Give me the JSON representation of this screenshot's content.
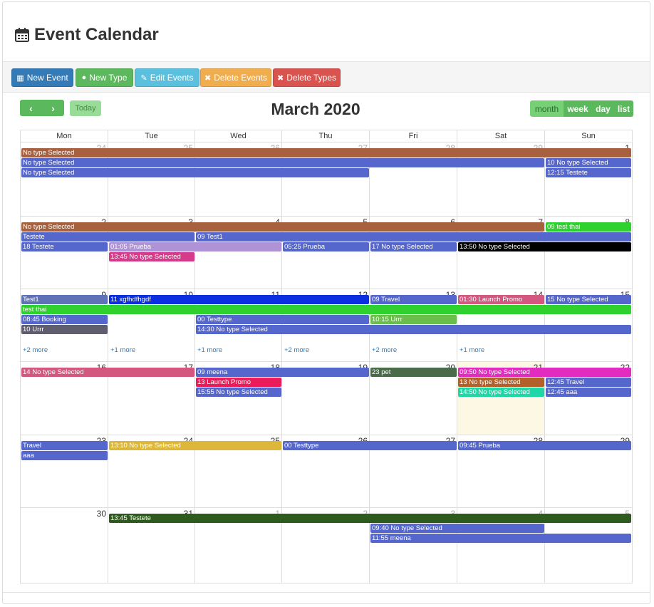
{
  "header": {
    "title": "Event Calendar"
  },
  "toolbar": {
    "new_event": "New Event",
    "new_type": "New Type",
    "edit_events": "Edit Events",
    "delete_events": "Delete Events",
    "delete_types": "Delete Types"
  },
  "calendar": {
    "title": "March 2020",
    "today": "Today",
    "views": [
      "month",
      "week",
      "day",
      "list"
    ],
    "active_view": "month",
    "weekdays": [
      "Mon",
      "Tue",
      "Wed",
      "Thu",
      "Fri",
      "Sat",
      "Sun"
    ],
    "weeks": [
      [
        {
          "d": "24",
          "o": true
        },
        {
          "d": "25",
          "o": true
        },
        {
          "d": "26",
          "o": true
        },
        {
          "d": "27",
          "o": true
        },
        {
          "d": "28",
          "o": true
        },
        {
          "d": "29",
          "o": true
        },
        {
          "d": "1"
        }
      ],
      [
        {
          "d": "2"
        },
        {
          "d": "3"
        },
        {
          "d": "4"
        },
        {
          "d": "5"
        },
        {
          "d": "6"
        },
        {
          "d": "7"
        },
        {
          "d": "8"
        }
      ],
      [
        {
          "d": "9"
        },
        {
          "d": "10"
        },
        {
          "d": "11"
        },
        {
          "d": "12"
        },
        {
          "d": "13"
        },
        {
          "d": "14"
        },
        {
          "d": "15"
        }
      ],
      [
        {
          "d": "16"
        },
        {
          "d": "17"
        },
        {
          "d": "18"
        },
        {
          "d": "19"
        },
        {
          "d": "20"
        },
        {
          "d": "21",
          "today": true
        },
        {
          "d": "22"
        }
      ],
      [
        {
          "d": "23"
        },
        {
          "d": "24"
        },
        {
          "d": "25"
        },
        {
          "d": "26"
        },
        {
          "d": "27"
        },
        {
          "d": "28"
        },
        {
          "d": "29"
        }
      ],
      [
        {
          "d": "30"
        },
        {
          "d": "31"
        },
        {
          "d": "1",
          "o": true
        },
        {
          "d": "2",
          "o": true
        },
        {
          "d": "3",
          "o": true
        },
        {
          "d": "4",
          "o": true
        },
        {
          "d": "5",
          "o": true
        }
      ]
    ],
    "events": [
      {
        "week": 0,
        "start": 0,
        "end": 6,
        "slot": 0,
        "label": "No type Selected",
        "color": "#a8613e"
      },
      {
        "week": 0,
        "start": 0,
        "end": 5,
        "slot": 1,
        "label": "No type Selected",
        "color": "#5566cc"
      },
      {
        "week": 0,
        "start": 6,
        "end": 6,
        "slot": 1,
        "label": "10 No type Selected",
        "color": "#5566cc"
      },
      {
        "week": 0,
        "start": 0,
        "end": 3,
        "slot": 2,
        "label": "No type Selected",
        "color": "#5566cc"
      },
      {
        "week": 0,
        "start": 6,
        "end": 6,
        "slot": 2,
        "label": "12:15 Testete",
        "color": "#5566cc"
      },
      {
        "week": 1,
        "start": 0,
        "end": 5,
        "slot": 0,
        "label": "No type Selected",
        "color": "#a8613e"
      },
      {
        "week": 1,
        "start": 6,
        "end": 6,
        "slot": 0,
        "label": "09 test thai",
        "color": "#2ed12e"
      },
      {
        "week": 1,
        "start": 0,
        "end": 1,
        "slot": 1,
        "label": "Testete",
        "color": "#5566cc"
      },
      {
        "week": 1,
        "start": 2,
        "end": 6,
        "slot": 1,
        "label": "09 Test1",
        "color": "#5566cc"
      },
      {
        "week": 1,
        "start": 0,
        "end": 0,
        "slot": 2,
        "label": "18 Testete",
        "color": "#5566cc"
      },
      {
        "week": 1,
        "start": 1,
        "end": 2,
        "slot": 2,
        "label": "01:05 Prueba",
        "color": "#b092d6"
      },
      {
        "week": 1,
        "start": 3,
        "end": 3,
        "slot": 2,
        "label": "05:25 Prueba",
        "color": "#5566cc"
      },
      {
        "week": 1,
        "start": 4,
        "end": 4,
        "slot": 2,
        "label": "17 No type Selected",
        "color": "#5566cc"
      },
      {
        "week": 1,
        "start": 5,
        "end": 6,
        "slot": 2,
        "label": "13:50 No type Selected",
        "color": "#000000"
      },
      {
        "week": 1,
        "start": 1,
        "end": 1,
        "slot": 3,
        "label": "13:45 No type Selected",
        "color": "#d63a8a"
      },
      {
        "week": 2,
        "start": 0,
        "end": 0,
        "slot": 0,
        "label": "Test1",
        "color": "#5f72b8"
      },
      {
        "week": 2,
        "start": 1,
        "end": 3,
        "slot": 0,
        "label": "11 xgfhdfhgdf",
        "color": "#0a2ee0"
      },
      {
        "week": 2,
        "start": 4,
        "end": 4,
        "slot": 0,
        "label": "09 Travel",
        "color": "#5566cc"
      },
      {
        "week": 2,
        "start": 5,
        "end": 5,
        "slot": 0,
        "label": "01:30 Launch Promo",
        "color": "#d4577f"
      },
      {
        "week": 2,
        "start": 6,
        "end": 6,
        "slot": 0,
        "label": "15 No type Selected",
        "color": "#5566cc"
      },
      {
        "week": 2,
        "start": 0,
        "end": 6,
        "slot": 1,
        "label": "test thai",
        "color": "#2ed12e"
      },
      {
        "week": 2,
        "start": 0,
        "end": 0,
        "slot": 2,
        "label": "08:45 Booking",
        "color": "#5566cc"
      },
      {
        "week": 2,
        "start": 2,
        "end": 3,
        "slot": 2,
        "label": "00 Testtype",
        "color": "#5566cc"
      },
      {
        "week": 2,
        "start": 4,
        "end": 4,
        "slot": 2,
        "label": "10:15 Urrr",
        "color": "#6abf4b"
      },
      {
        "week": 2,
        "start": 0,
        "end": 0,
        "slot": 3,
        "label": "10 Urrr",
        "color": "#5e5e6e"
      },
      {
        "week": 2,
        "start": 2,
        "end": 6,
        "slot": 3,
        "label": "14:30 No type Selected",
        "color": "#5566cc"
      },
      {
        "week": 3,
        "start": 0,
        "end": 1,
        "slot": 0,
        "label": "14 No type Selected",
        "color": "#d4577f"
      },
      {
        "week": 3,
        "start": 2,
        "end": 3,
        "slot": 0,
        "label": "09 meena",
        "color": "#5566cc"
      },
      {
        "week": 3,
        "start": 4,
        "end": 4,
        "slot": 0,
        "label": "23 pet",
        "color": "#4a6b4a"
      },
      {
        "week": 3,
        "start": 5,
        "end": 6,
        "slot": 0,
        "label": "09:50 No type Selected",
        "color": "#e22bbf"
      },
      {
        "week": 3,
        "start": 2,
        "end": 2,
        "slot": 1,
        "label": "13 Launch Promo",
        "color": "#ea1c5a"
      },
      {
        "week": 3,
        "start": 5,
        "end": 5,
        "slot": 1,
        "label": "13 No type Selected",
        "color": "#b3602b"
      },
      {
        "week": 3,
        "start": 6,
        "end": 6,
        "slot": 1,
        "label": "12:45 Travel",
        "color": "#5566cc"
      },
      {
        "week": 3,
        "start": 2,
        "end": 2,
        "slot": 2,
        "label": "15:55 No type Selected",
        "color": "#5566cc"
      },
      {
        "week": 3,
        "start": 5,
        "end": 5,
        "slot": 2,
        "label": "14:50 No type Selected",
        "color": "#1fd6a6"
      },
      {
        "week": 3,
        "start": 6,
        "end": 6,
        "slot": 2,
        "label": "12:45 aaa",
        "color": "#5566cc"
      },
      {
        "week": 4,
        "start": 0,
        "end": 0,
        "slot": 0,
        "label": "Travel",
        "color": "#5566cc"
      },
      {
        "week": 4,
        "start": 1,
        "end": 2,
        "slot": 0,
        "label": "13:10 No type Selected",
        "color": "#dcb73a"
      },
      {
        "week": 4,
        "start": 3,
        "end": 4,
        "slot": 0,
        "label": "00 Testtype",
        "color": "#5566cc"
      },
      {
        "week": 4,
        "start": 5,
        "end": 6,
        "slot": 0,
        "label": "09:45 Prueba",
        "color": "#5566cc"
      },
      {
        "week": 4,
        "start": 0,
        "end": 0,
        "slot": 1,
        "label": "aaa",
        "color": "#5566cc"
      },
      {
        "week": 5,
        "start": 1,
        "end": 6,
        "slot": 0,
        "label": "13:45 Testete",
        "color": "#2f5a1e"
      },
      {
        "week": 5,
        "start": 4,
        "end": 5,
        "slot": 1,
        "label": "09:40 No type Selected",
        "color": "#5566cc"
      },
      {
        "week": 5,
        "start": 4,
        "end": 6,
        "slot": 2,
        "label": "11:55 meena",
        "color": "#5566cc"
      }
    ],
    "more_links": [
      {
        "week": 2,
        "day": 0,
        "label": "+2 more"
      },
      {
        "week": 2,
        "day": 1,
        "label": "+1 more"
      },
      {
        "week": 2,
        "day": 2,
        "label": "+1 more"
      },
      {
        "week": 2,
        "day": 3,
        "label": "+2 more"
      },
      {
        "week": 2,
        "day": 4,
        "label": "+2 more"
      },
      {
        "week": 2,
        "day": 5,
        "label": "+1 more"
      }
    ]
  }
}
